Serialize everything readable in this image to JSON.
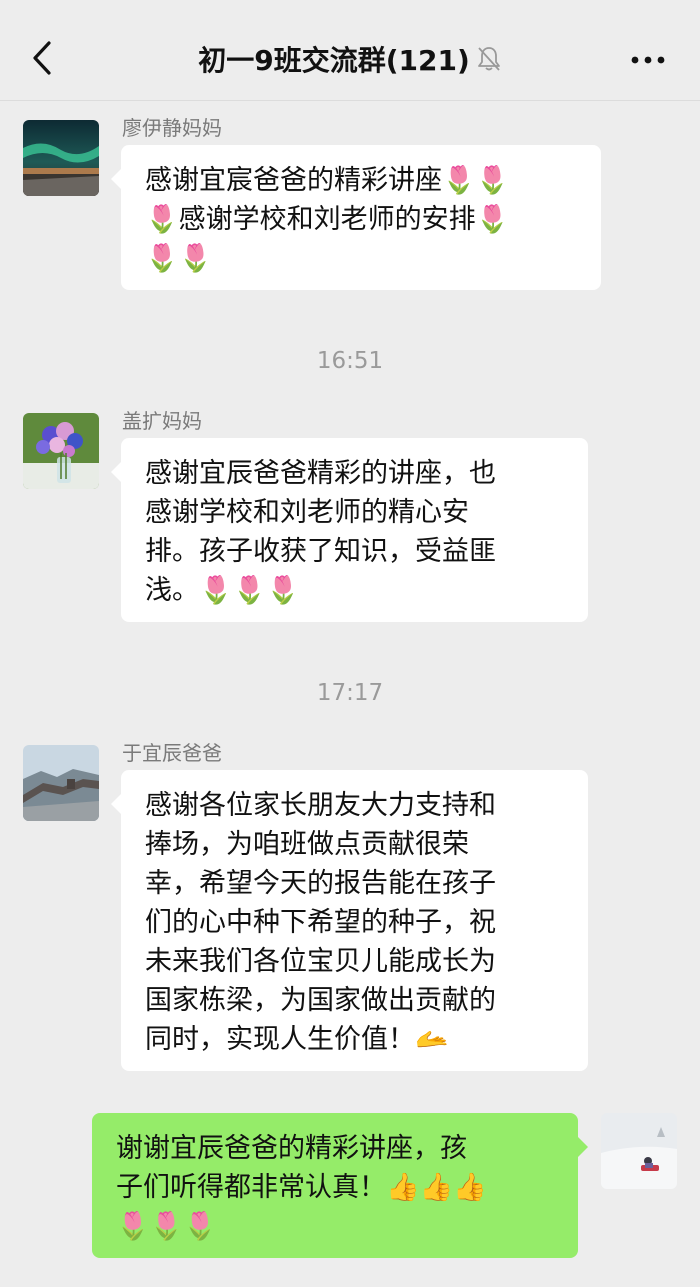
{
  "header": {
    "back_icon": "chevron-left-icon",
    "title": "初一9班交流群(121)",
    "mute_icon": "bell-muted-icon",
    "more_icon": "more-dots-icon"
  },
  "messages": [
    {
      "sender": "廖伊静妈妈",
      "avatar_icon": "aurora-landscape-avatar",
      "lines": [
        {
          "text": "感谢宜宸爸爸的精彩讲座",
          "emoji": "🌷🌷"
        },
        {
          "text": "",
          "emoji_lead": "🌷",
          "text2": "感谢学校和刘老师的安排",
          "emoji": "🌷"
        },
        {
          "text": "",
          "emoji": "🌷🌷"
        }
      ]
    },
    {
      "timestamp": "16:51"
    },
    {
      "sender": "盖扩妈妈",
      "avatar_icon": "flower-vase-avatar",
      "lines": [
        {
          "text": "感谢宜辰爸爸精彩的讲座，也"
        },
        {
          "text": "感谢学校和刘老师的精心安"
        },
        {
          "text": "排。孩子收获了知识，受益匪"
        },
        {
          "text": "浅。",
          "emoji": "🌷🌷🌷"
        }
      ]
    },
    {
      "timestamp": "17:17"
    },
    {
      "sender": "于宜辰爸爸",
      "avatar_icon": "great-wall-avatar",
      "lines": [
        {
          "text": "感谢各位家长朋友大力支持和"
        },
        {
          "text": "捧场，为咱班做点贡献很荣"
        },
        {
          "text": "幸，希望今天的报告能在孩子"
        },
        {
          "text": "们的心中种下希望的种子，祝"
        },
        {
          "text": "未来我们各位宝贝儿能成长为"
        },
        {
          "text": "国家栋梁，为国家做出贡献的"
        },
        {
          "text": "同时，实现人生价值！",
          "emoji": "🫴"
        }
      ]
    },
    {
      "self": true,
      "avatar_icon": "snow-sled-avatar",
      "lines": [
        {
          "text": "谢谢宜辰爸爸的精彩讲座，孩"
        },
        {
          "text": "子们听得都非常认真！",
          "emoji": "👍👍👍"
        },
        {
          "text": "",
          "emoji": "🌷🌷🌷"
        }
      ]
    }
  ],
  "colors": {
    "background": "#ededed",
    "bubble_self": "#95ec69",
    "bubble_other": "#ffffff",
    "sender_name": "#7a7a7a",
    "timestamp": "#9a9a9a"
  }
}
